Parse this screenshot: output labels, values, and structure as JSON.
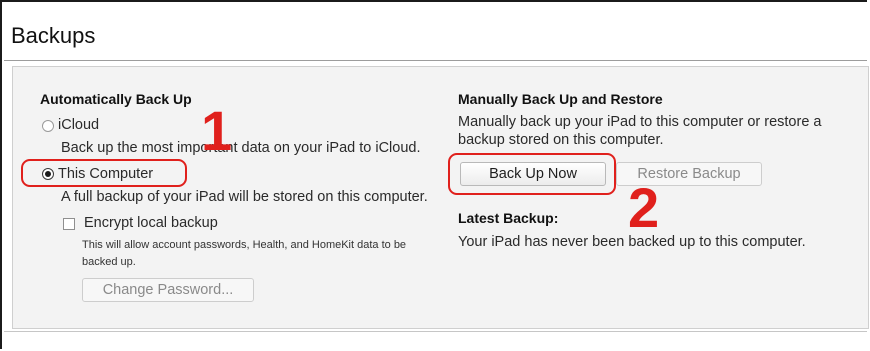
{
  "section_title": "Backups",
  "auto_backup": {
    "heading": "Automatically Back Up",
    "icloud_label": "iCloud",
    "icloud_desc": "Back up the most important data on your iPad to iCloud.",
    "computer_label": "This Computer",
    "computer_desc": "A full backup of your iPad will be stored on this computer.",
    "encrypt_label": "Encrypt local backup",
    "encrypt_desc_line1": "This will allow account passwords, Health, and HomeKit data to be",
    "encrypt_desc_line2": "backed up.",
    "change_password_label": "Change Password..."
  },
  "manual_backup": {
    "heading": "Manually Back Up and Restore",
    "desc_line1": "Manually back up your iPad to this computer or restore a",
    "desc_line2": "backup stored on this computer.",
    "back_up_now_label": "Back Up Now",
    "restore_label": "Restore Backup",
    "latest_heading": "Latest Backup:",
    "latest_text": "Your iPad has never been backed up to this computer."
  },
  "annotations": {
    "step1": "1",
    "step2": "2",
    "color": "#e0201c"
  },
  "selected_backup_option": "This Computer"
}
